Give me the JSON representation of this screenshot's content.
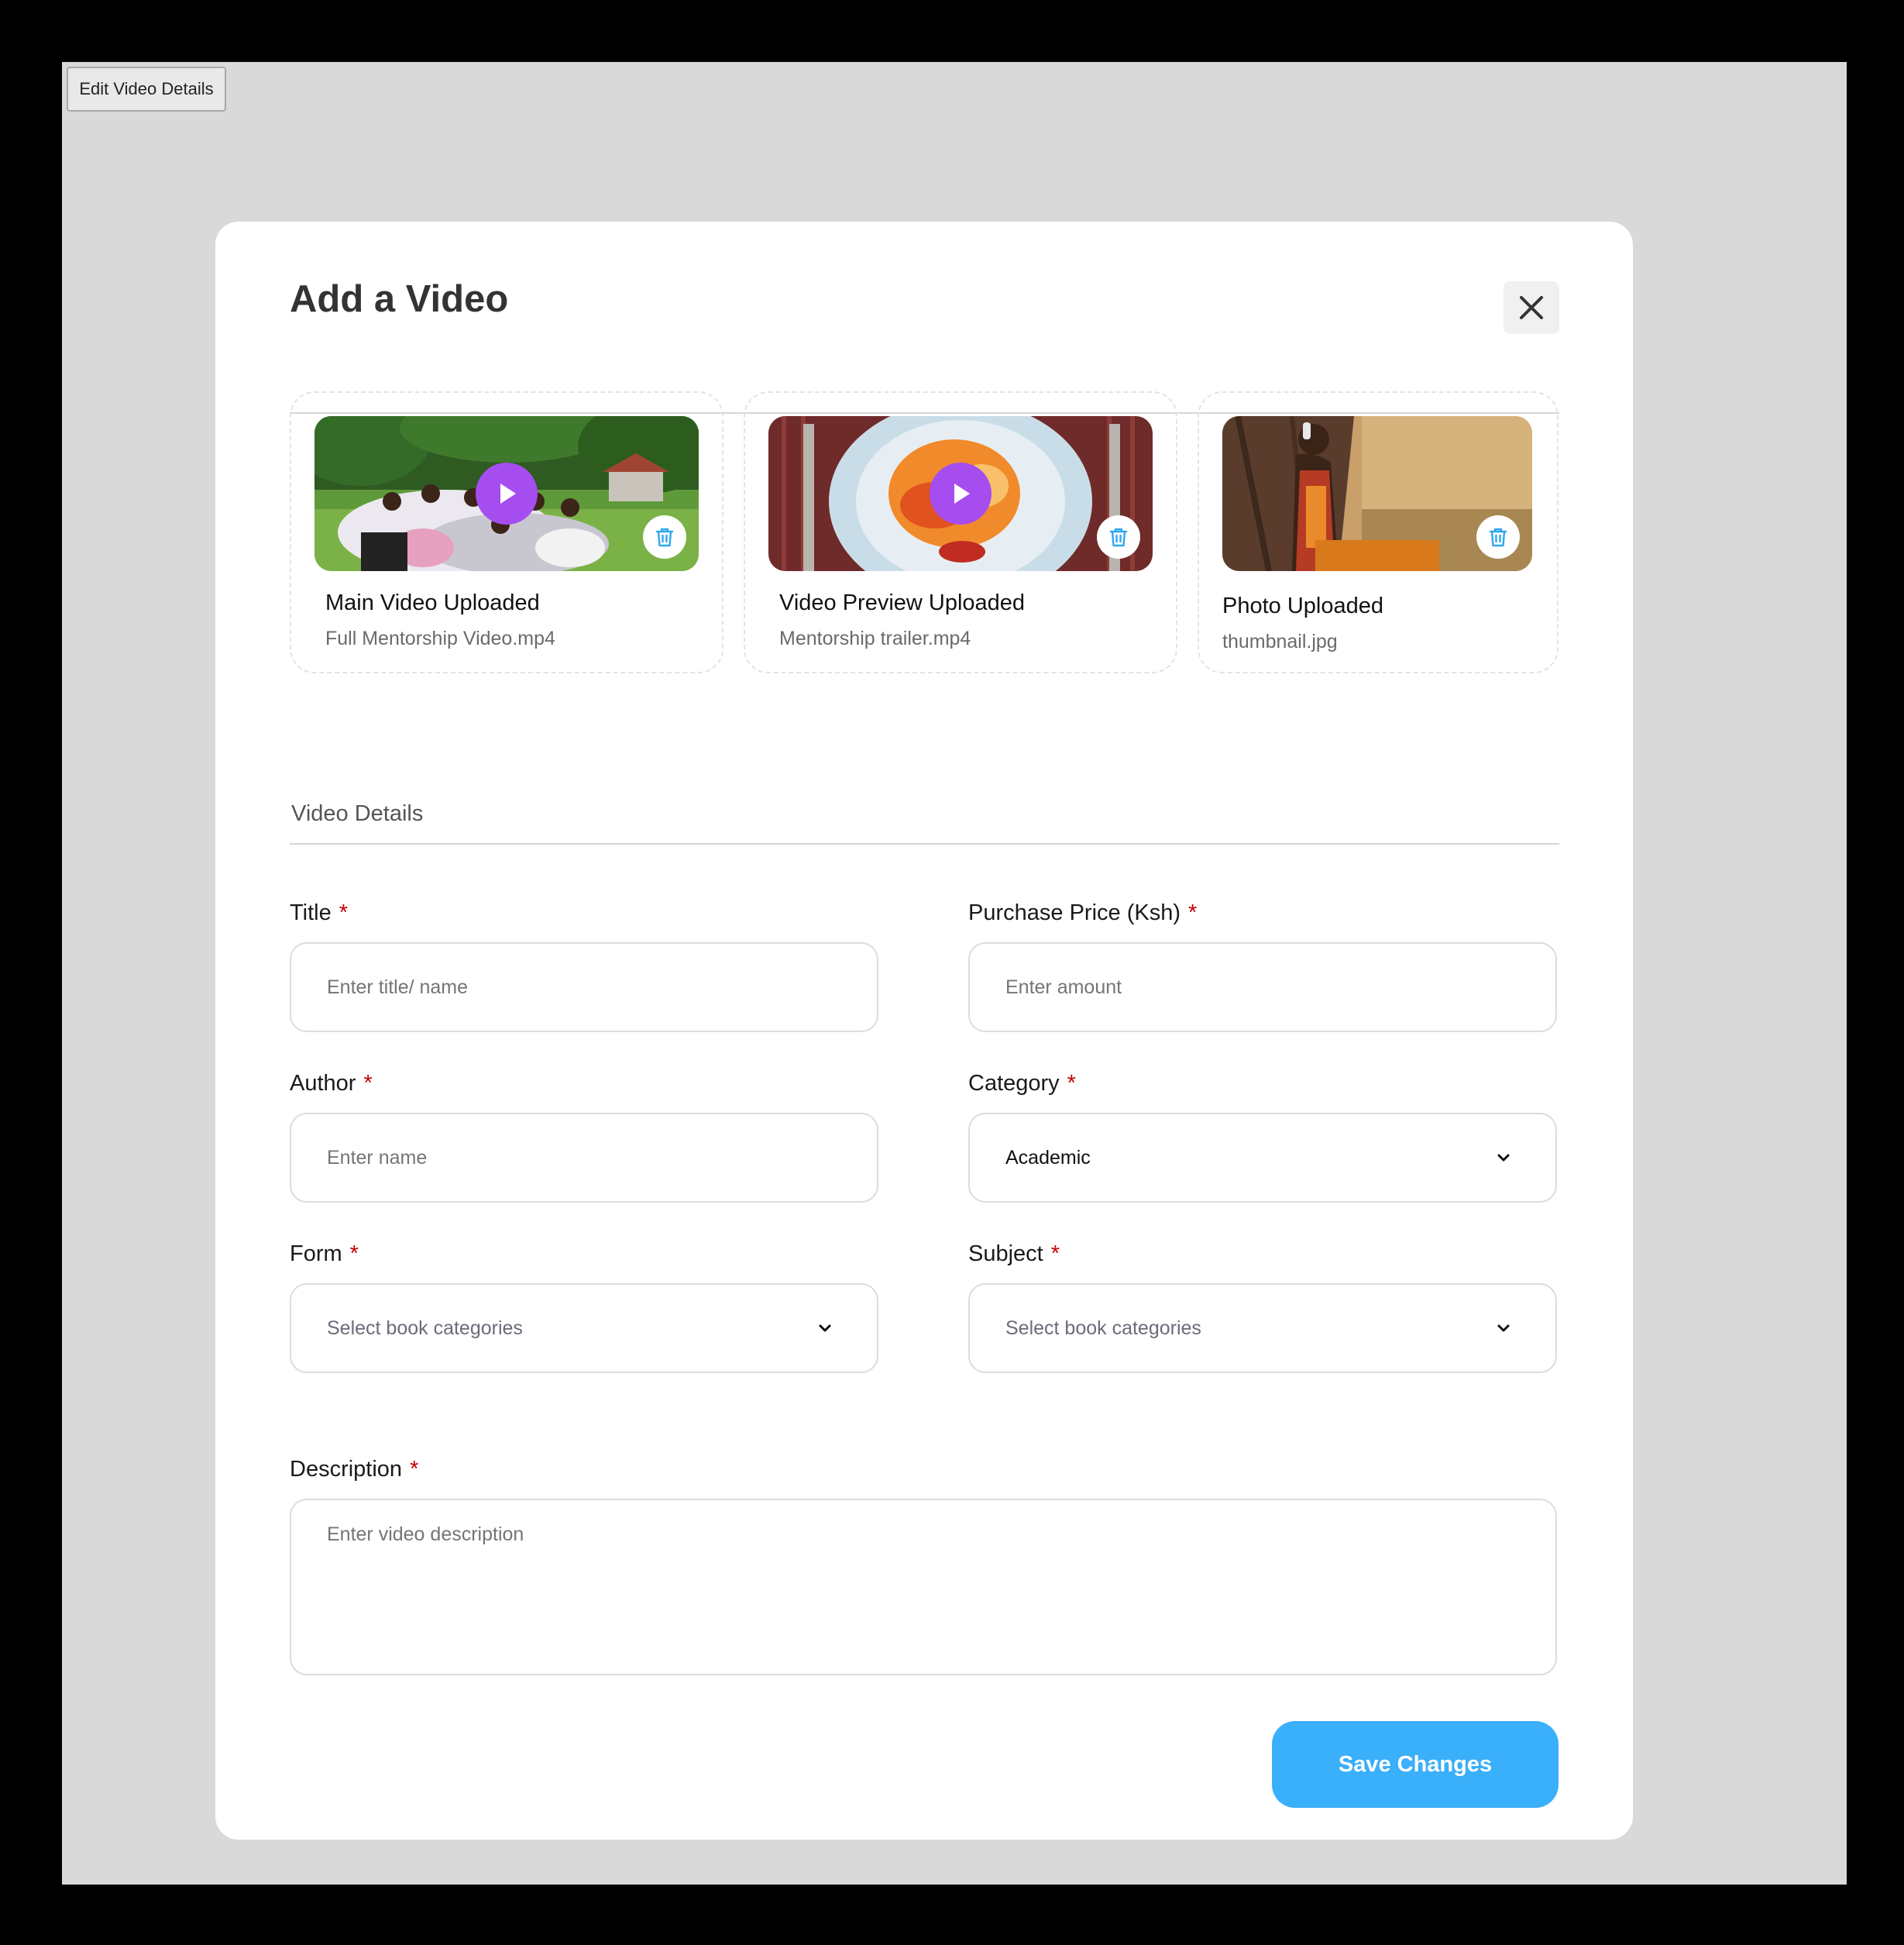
{
  "toolbar": {
    "edit_button_label": "Edit Video Details"
  },
  "modal": {
    "title": "Add a Video",
    "uploads": [
      {
        "title": "Main Video Uploaded",
        "file": "Full Mentorship Video.mp4",
        "kind": "video"
      },
      {
        "title": "Video Preview Uploaded",
        "file": "Mentorship trailer.mp4",
        "kind": "video"
      },
      {
        "title": "Photo Uploaded",
        "file": "thumbnail.jpg",
        "kind": "photo"
      }
    ],
    "section_label": "Video Details",
    "fields": {
      "title": {
        "label": "Title",
        "required": "*",
        "placeholder": "Enter title/ name",
        "value": ""
      },
      "price": {
        "label": "Purchase Price (Ksh)",
        "required": "*",
        "placeholder": "Enter amount",
        "value": ""
      },
      "author": {
        "label": "Author",
        "required": "*",
        "placeholder": "Enter name",
        "value": ""
      },
      "category": {
        "label": "Category",
        "required": "*",
        "value": "Academic"
      },
      "form": {
        "label": "Form",
        "required": "*",
        "placeholder": "Select book categories"
      },
      "subject": {
        "label": "Subject",
        "required": "*",
        "placeholder": "Select book categories"
      },
      "description": {
        "label": "Description",
        "required": "*",
        "placeholder": "Enter video description",
        "value": ""
      }
    },
    "save_label": "Save Changes"
  },
  "icons": {
    "close": "close-icon",
    "play": "play-icon",
    "trash": "trash-icon",
    "chevron": "chevron-down-icon"
  },
  "colors": {
    "accent": "#3aaffa",
    "play": "#a64df0",
    "required": "#c40000",
    "backdrop": "#d9d9d9"
  }
}
